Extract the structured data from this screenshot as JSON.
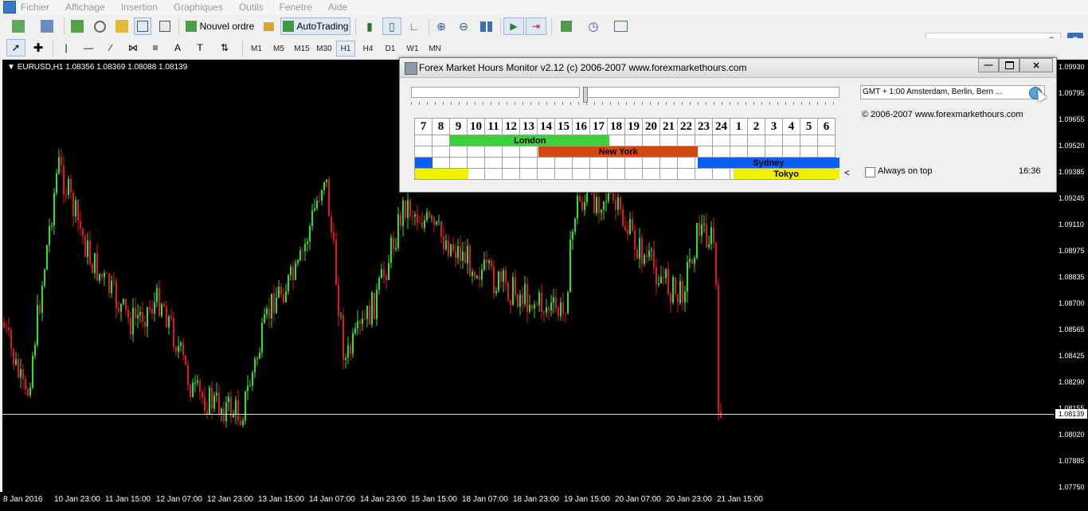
{
  "menu": [
    "Fichier",
    "Affichage",
    "Insertion",
    "Graphiques",
    "Outils",
    "Fenetre",
    "Aide"
  ],
  "toolbar": {
    "new_order_label": "Nouvel ordre",
    "autotrading_label": "AutoTrading",
    "search_badge": "5"
  },
  "timeframes": [
    "M1",
    "M5",
    "M15",
    "M30",
    "H1",
    "H4",
    "D1",
    "W1",
    "MN"
  ],
  "active_timeframe": "H1",
  "chart": {
    "title": "EURUSD,H1  1.08356 1.08369 1.08088 1.08139",
    "price_ticks": [
      "1.09930",
      "1.09795",
      "1.09655",
      "1.09520",
      "1.09385",
      "1.09245",
      "1.09110",
      "1.08975",
      "1.08835",
      "1.08700",
      "1.08565",
      "1.08425",
      "1.08290",
      "1.08155",
      "1.08020",
      "1.07885",
      "1.07750"
    ],
    "current_price": "1.08139",
    "time_labels": [
      "8 Jan 2016",
      "10 Jan 23:00",
      "11 Jan 15:00",
      "12 Jan 07:00",
      "12 Jan 23:00",
      "13 Jan 15:00",
      "14 Jan 07:00",
      "14 Jan 23:00",
      "15 Jan 15:00",
      "18 Jan 07:00",
      "18 Jan 23:00",
      "19 Jan 15:00",
      "20 Jan 07:00",
      "20 Jan 23:00",
      "21 Jan 15:00"
    ],
    "colors": {
      "bull": "#2ee02e",
      "bear": "#e01818",
      "background": "#000000"
    }
  },
  "fmh": {
    "title": "Forex Market Hours Monitor v2.12  (c) 2006-2007 www.forexmarkethours.com",
    "hours": [
      "7",
      "8",
      "9",
      "10",
      "11",
      "12",
      "13",
      "14",
      "15",
      "16",
      "17",
      "18",
      "19",
      "20",
      "21",
      "22",
      "23",
      "24",
      "1",
      "2",
      "3",
      "4",
      "5",
      "6"
    ],
    "sessions": [
      {
        "name": "London",
        "color": "#39d339"
      },
      {
        "name": "New York",
        "color": "#d04a10"
      },
      {
        "name": "Sydney",
        "color": "#0a5ff0"
      },
      {
        "name": "Tokyo",
        "color": "#f0f000"
      }
    ],
    "timezone": "GMT + 1:00 Amsterdam, Berlin, Bern ...",
    "copyright": "© 2006-2007 www.forexmarkethours.com",
    "left_arrow": "<",
    "always_on_top": "Always on top",
    "time": "16:36",
    "btn_min": "—",
    "btn_close": "✕"
  }
}
